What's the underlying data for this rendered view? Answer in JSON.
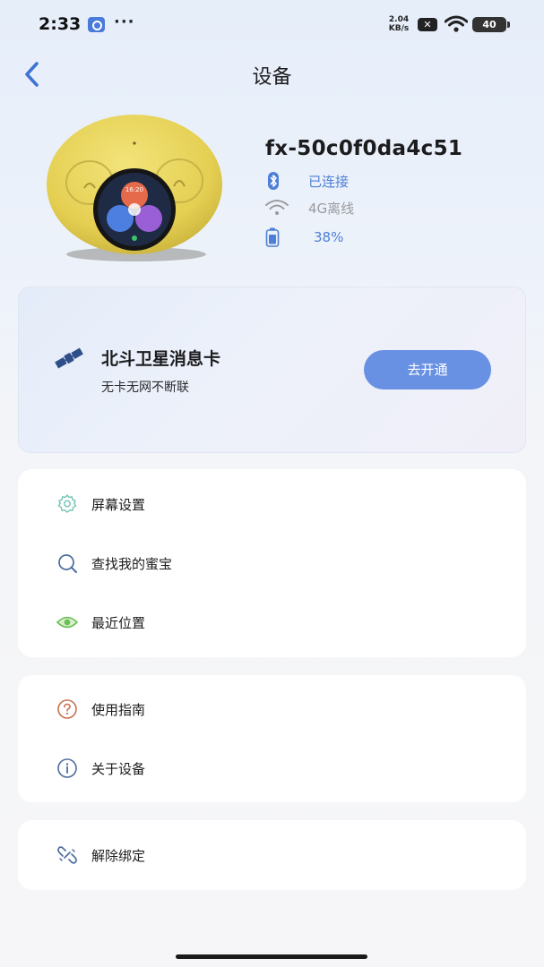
{
  "status_bar": {
    "time": "2:33",
    "more": "···",
    "net_speed_value": "2.04",
    "net_speed_unit": "KB/s",
    "x_badge": "✕",
    "battery_level": "40"
  },
  "nav": {
    "title": "设备",
    "back_icon": "chevron-left-icon"
  },
  "device": {
    "name": "fx-50c0f0da4c51",
    "bluetooth_status": "已连接",
    "network_status": "4G离线",
    "battery": "38%",
    "screen_time": "16:20",
    "colors": {
      "accent": "#4e7fd6",
      "muted": "#9a9a9f",
      "body_yellow": "#e8d35a"
    }
  },
  "beidou": {
    "title": "北斗卫星消息卡",
    "subtitle": "无卡无网不断联",
    "button_label": "去开通",
    "button_color": "#6891e3",
    "icon": "satellite-icon"
  },
  "menu_groups": [
    {
      "items": [
        {
          "label": "屏幕设置",
          "icon": "gear-icon"
        },
        {
          "label": "查找我的蜜宝",
          "icon": "search-icon"
        },
        {
          "label": "最近位置",
          "icon": "eye-location-icon"
        }
      ]
    },
    {
      "items": [
        {
          "label": "使用指南",
          "icon": "question-icon"
        },
        {
          "label": "关于设备",
          "icon": "info-icon"
        }
      ]
    },
    {
      "items": [
        {
          "label": "解除绑定",
          "icon": "unlink-icon"
        }
      ]
    }
  ]
}
